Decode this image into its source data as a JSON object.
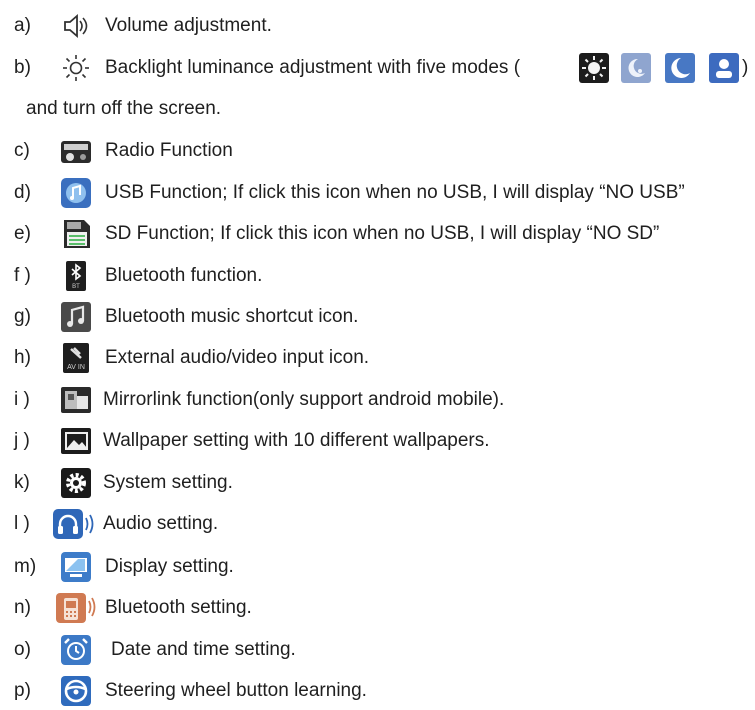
{
  "items": [
    {
      "letter": "a)",
      "text": "Volume adjustment.",
      "icon": "speaker-icon"
    },
    {
      "letter": "b)",
      "text": "Backlight luminance adjustment with five modes (",
      "icon": "sun-outline-icon"
    },
    {
      "letter": "c)",
      "text": "Radio Function",
      "icon": "radio-icon"
    },
    {
      "letter": "d)",
      "text": "USB Function; If click this icon when no USB, I will display “NO  USB”",
      "icon": "usb-music-icon"
    },
    {
      "letter": "e)",
      "text": "SD Function; If click this icon when no USB, I will display “NO  SD”",
      "icon": "sd-card-icon"
    },
    {
      "letter": "f )",
      "text": "Bluetooth function.",
      "icon": "bluetooth-icon"
    },
    {
      "letter": "g)",
      "text": "Bluetooth music shortcut icon.",
      "icon": "music-note-icon"
    },
    {
      "letter": "h)",
      "text": "External audio/video input icon.",
      "icon": "av-in-icon"
    },
    {
      "letter": "i )",
      "text": "Mirrorlink function(only support android mobile).",
      "icon": "mirrorlink-icon"
    },
    {
      "letter": "j )",
      "text": "Wallpaper setting with 10 different wallpapers.",
      "icon": "wallpaper-icon"
    },
    {
      "letter": "k)",
      "text": "System setting.",
      "icon": "gear-icon"
    },
    {
      "letter": "l )",
      "text": "Audio setting.",
      "icon": "headphones-icon"
    },
    {
      "letter": "m)",
      "text": "Display setting.",
      "icon": "monitor-icon"
    },
    {
      "letter": "n)",
      "text": "Bluetooth setting.",
      "icon": "bluetooth-phone-icon"
    },
    {
      "letter": "o)",
      "text": "Date and time setting.",
      "icon": "alarm-clock-icon"
    },
    {
      "letter": "p)",
      "text": "Steering wheel button learning.",
      "icon": "steering-wheel-icon"
    }
  ],
  "modes_close": ")",
  "continuation": "and turn off the screen.",
  "mode_icons": [
    "sun-mode-icon",
    "moon-cloud-mode-icon",
    "moon-mode-icon",
    "user-mode-icon"
  ]
}
